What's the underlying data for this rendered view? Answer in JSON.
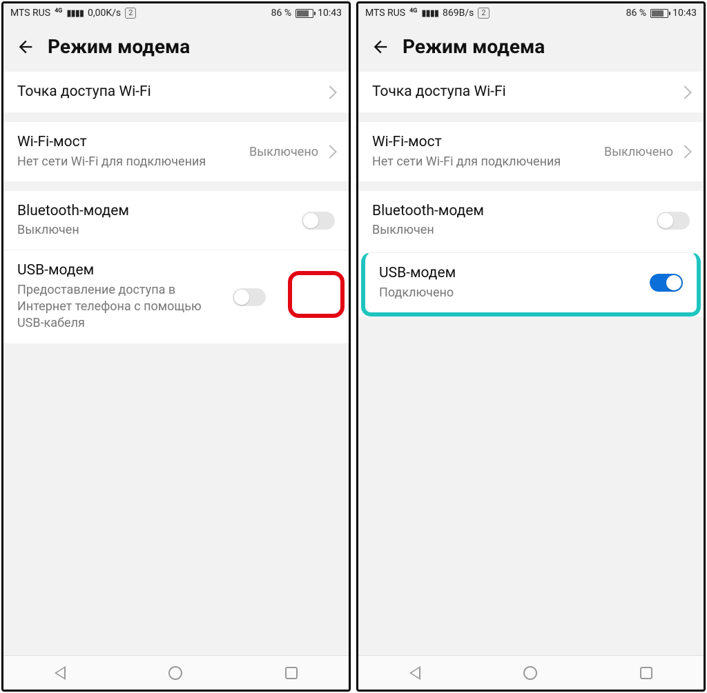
{
  "phones": [
    {
      "statusbar": {
        "carrier": "MTS RUS",
        "net_type": "4G",
        "data_rate": "0,00K/s",
        "sim": "2",
        "battery_pct": "86 %",
        "time": "10:43"
      },
      "header": {
        "title": "Режим модема"
      },
      "wifi_hotspot": {
        "title": "Точка доступа Wi-Fi"
      },
      "wifi_bridge": {
        "title": "Wi-Fi-мост",
        "sub": "Нет сети Wi-Fi для подключения",
        "value": "Выключено"
      },
      "bt_tether": {
        "title": "Bluetooth-модем",
        "sub": "Выключен",
        "on": false
      },
      "usb_tether": {
        "title": "USB-модем",
        "sub": "Предоставление доступа в Интернет телефона с помощью USB-кабеля",
        "on": false
      }
    },
    {
      "statusbar": {
        "carrier": "MTS RUS",
        "net_type": "4G",
        "data_rate": "869B/s",
        "sim": "2",
        "battery_pct": "86 %",
        "time": "10:43"
      },
      "header": {
        "title": "Режим модема"
      },
      "wifi_hotspot": {
        "title": "Точка доступа Wi-Fi"
      },
      "wifi_bridge": {
        "title": "Wi-Fi-мост",
        "sub": "Нет сети Wi-Fi для подключения",
        "value": "Выключено"
      },
      "bt_tether": {
        "title": "Bluetooth-модем",
        "sub": "Выключен",
        "on": false
      },
      "usb_tether": {
        "title": "USB-модем",
        "sub": "Подключено",
        "on": true
      }
    }
  ]
}
